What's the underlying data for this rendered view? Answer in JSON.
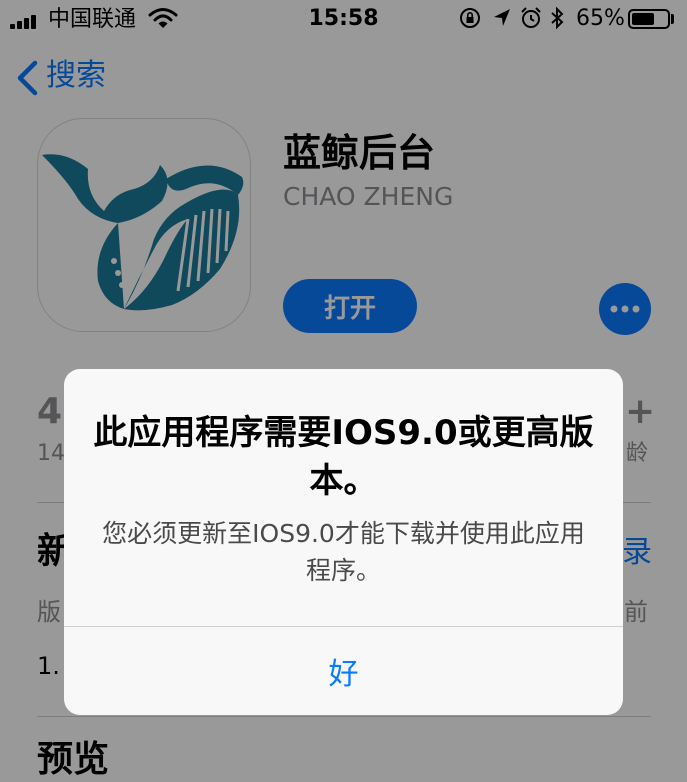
{
  "status_bar": {
    "carrier": "中国联通",
    "time": "15:58",
    "battery_percent": "65%",
    "battery_level": 0.65,
    "icons": [
      "signal-icon",
      "wifi-icon",
      "rotation-lock-icon",
      "location-icon",
      "alarm-icon",
      "bluetooth-icon",
      "battery-icon"
    ]
  },
  "nav": {
    "back_label": "搜索",
    "back_icon": "chevron-left-icon"
  },
  "app": {
    "name": "蓝鲸后台",
    "developer": "CHAO ZHENG",
    "open_label": "打开",
    "more_icon": "ellipsis-icon",
    "icon": "whale-logo-icon",
    "icon_color": "#1d7a9a"
  },
  "stats": {
    "rating_partial": "4",
    "ratings_partial": "14",
    "age_partial": "+",
    "age_label_partial": "龄"
  },
  "sections": {
    "whats_new_partial": "新",
    "version_history_partial": "录",
    "version_partial": "版",
    "date_partial": "前",
    "note_partial": "1.",
    "preview_title": "预览"
  },
  "alert": {
    "title": "此应用程序需要IOS9.0或更高版本。",
    "message": "您必须更新至IOS9.0才能下载并使用此应用程序。",
    "ok_label": "好"
  },
  "colors": {
    "accent": "#0a7aff",
    "secondary_text": "#8e8e93",
    "overlay": "rgba(0,0,0,0.4)",
    "alert_background": "#f8f8f8"
  }
}
